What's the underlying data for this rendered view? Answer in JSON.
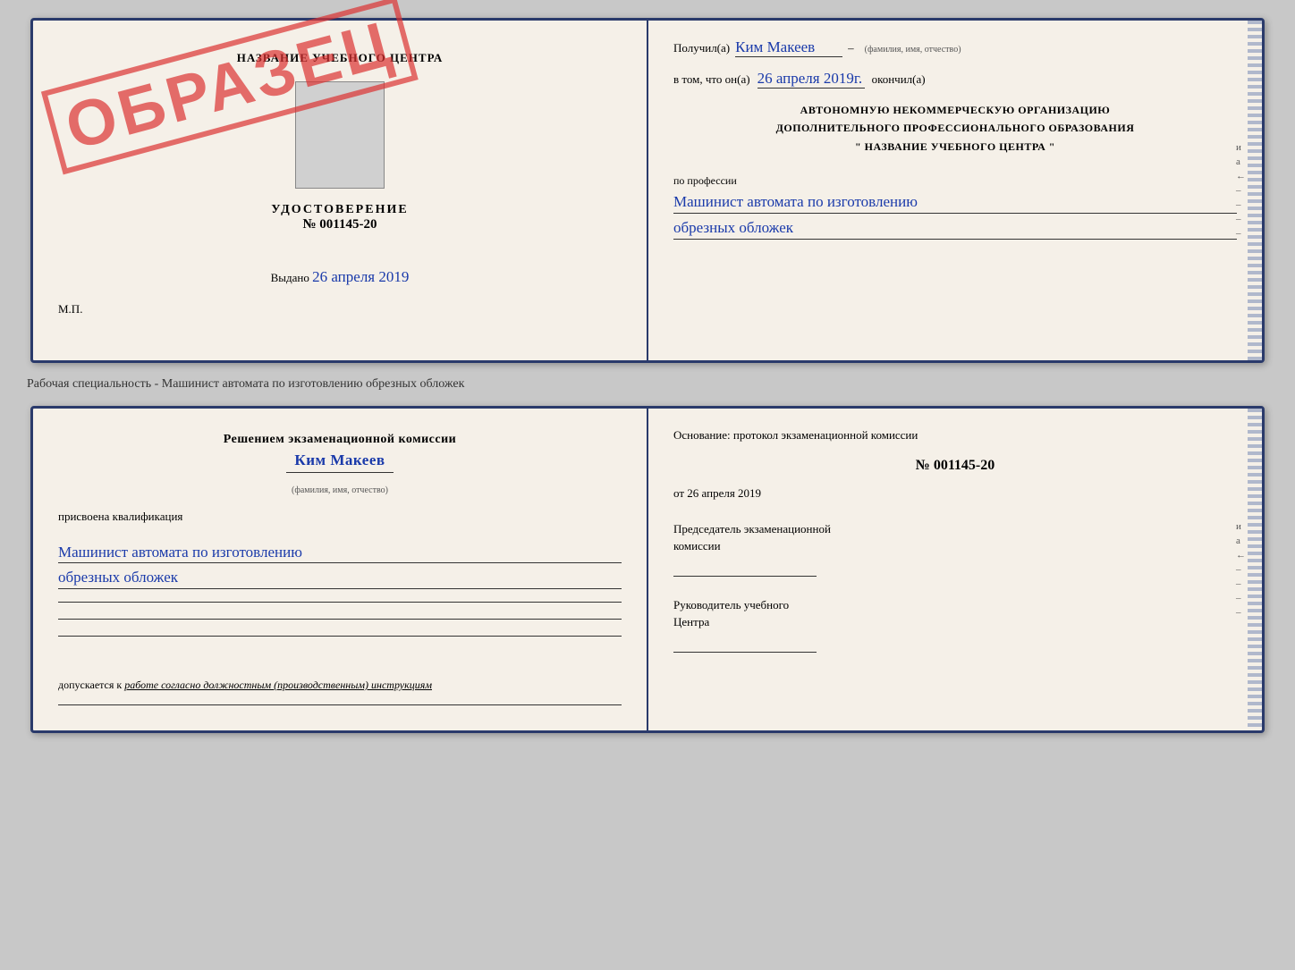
{
  "top": {
    "left": {
      "school_name": "НАЗВАНИЕ УЧЕБНОГО ЦЕНТРА",
      "doc_type": "УДОСТОВЕРЕНИЕ",
      "doc_number": "№ 001145-20",
      "vydano_label": "Выдано",
      "vydano_date": "26 апреля 2019",
      "mp_label": "М.П.",
      "stamp_text": "ОБРАЗЕЦ"
    },
    "right": {
      "poluchil_label": "Получил(а)",
      "recipient_name": "Ким Макеев",
      "fio_label": "(фамилия, имя, отчество)",
      "vtom_label": "в том, что он(а)",
      "completion_date": "26 апреля 2019г.",
      "okonchil_label": "окончил(а)",
      "org_line1": "АВТОНОМНУЮ НЕКОММЕРЧЕСКУЮ ОРГАНИЗАЦИЮ",
      "org_line2": "ДОПОЛНИТЕЛЬНОГО ПРОФЕССИОНАЛЬНОГО ОБРАЗОВАНИЯ",
      "org_line3": "\"  НАЗВАНИЕ УЧЕБНОГО ЦЕНТРА  \"",
      "po_professii": "по профессии",
      "profession_line1": "Машинист автомата по изготовлению",
      "profession_line2": "обрезных обложек"
    }
  },
  "separator": {
    "text": "Рабочая специальность - Машинист автомата по изготовлению обрезных обложек"
  },
  "bottom": {
    "left": {
      "commission_line1": "Решением экзаменационной комиссии",
      "person_name": "Ким Макеев",
      "fio_label": "(фамилия, имя, отчество)",
      "prisvoena_label": "присвоена квалификация",
      "qualification_line1": "Машинист автомата по изготовлению",
      "qualification_line2": "обрезных обложек",
      "dopuskaetsya_label": "допускается к",
      "dopuskaetsya_value": "работе согласно должностным (производственным) инструкциям"
    },
    "right": {
      "osnovaniye_label": "Основание: протокол экзаменационной комиссии",
      "protocol_number": "№  001145-20",
      "ot_label": "от",
      "protocol_date": "26 апреля 2019",
      "chairman_line1": "Председатель экзаменационной",
      "chairman_line2": "комиссии",
      "rukovoditel_line1": "Руководитель учебного",
      "rukovoditel_line2": "Центра"
    }
  },
  "side_letters": [
    "и",
    "а",
    "←",
    "–",
    "–",
    "–",
    "–"
  ]
}
